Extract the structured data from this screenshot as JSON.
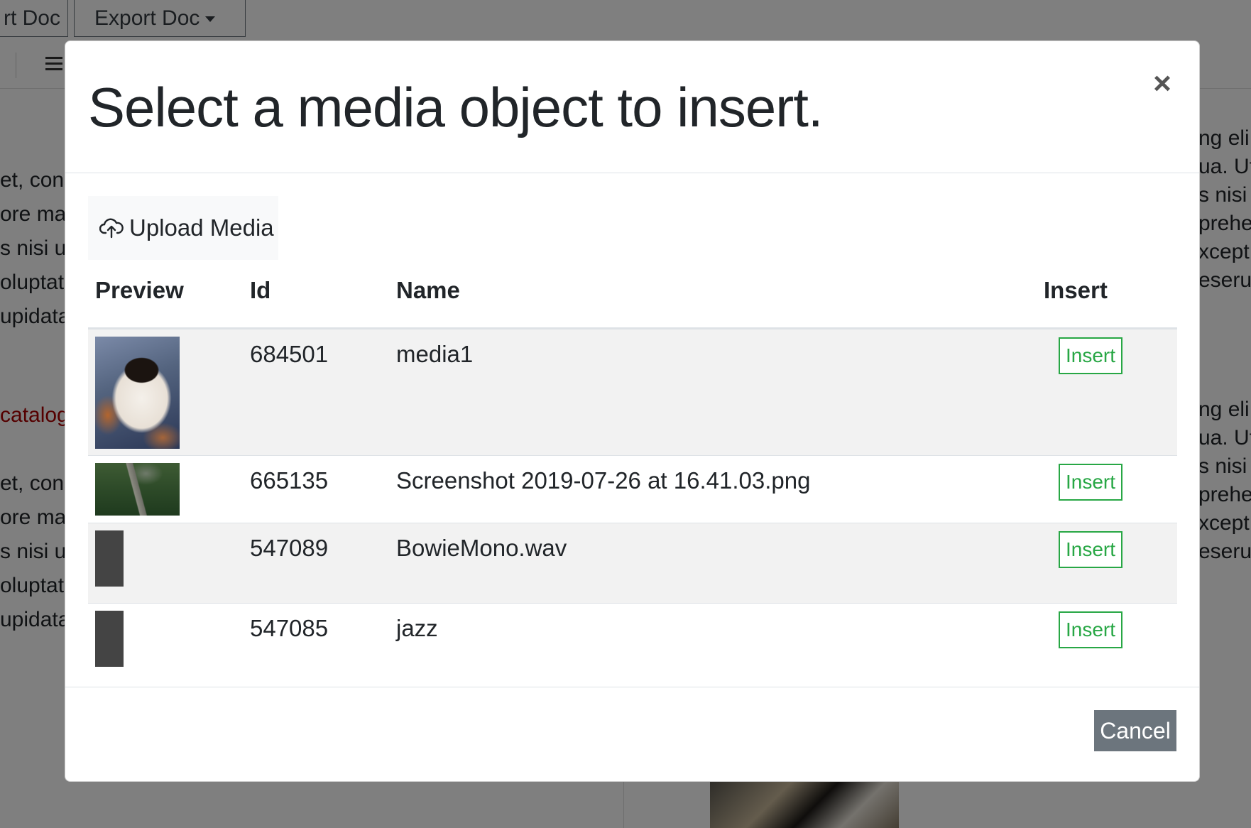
{
  "background": {
    "toolbar": {
      "import_label": "rt Doc",
      "export_label": "Export Doc"
    },
    "left_text": [
      "et, cons",
      "ore mag",
      "s nisi u",
      "oluptat",
      "upidata"
    ],
    "left_text_2": [
      "et, cons",
      "ore mag",
      "s nisi u",
      "oluptat",
      "upidata"
    ],
    "right_text": [
      "ng eli",
      "ua. Ut",
      "s nisi u",
      "prehen",
      "xcept",
      "eseru"
    ],
    "right_text_2": [
      "ng eli",
      "ua. Ut",
      "s nisi u",
      "prehen",
      "xcept",
      "eseru"
    ],
    "link_text": "catalog"
  },
  "modal": {
    "title": "Select a media object to insert.",
    "close_label": "×",
    "upload_label": "Upload Media",
    "columns": {
      "preview": "Preview",
      "id": "Id",
      "name": "Name",
      "insert": "Insert"
    },
    "rows": [
      {
        "id": "684501",
        "name": "media1",
        "thumb": "photo-cat",
        "insert_label": "Insert"
      },
      {
        "id": "665135",
        "name": "Screenshot 2019-07-26 at 16.41.03.png",
        "thumb": "photo-scene",
        "insert_label": "Insert"
      },
      {
        "id": "547089",
        "name": "BowieMono.wav",
        "thumb": "audio",
        "insert_label": "Insert"
      },
      {
        "id": "547085",
        "name": "jazz",
        "thumb": "audio",
        "insert_label": "Insert"
      }
    ],
    "cancel_label": "Cancel"
  },
  "colors": {
    "insert_green": "#28a745",
    "cancel_gray": "#6c757d",
    "link_red": "#aa0000"
  }
}
